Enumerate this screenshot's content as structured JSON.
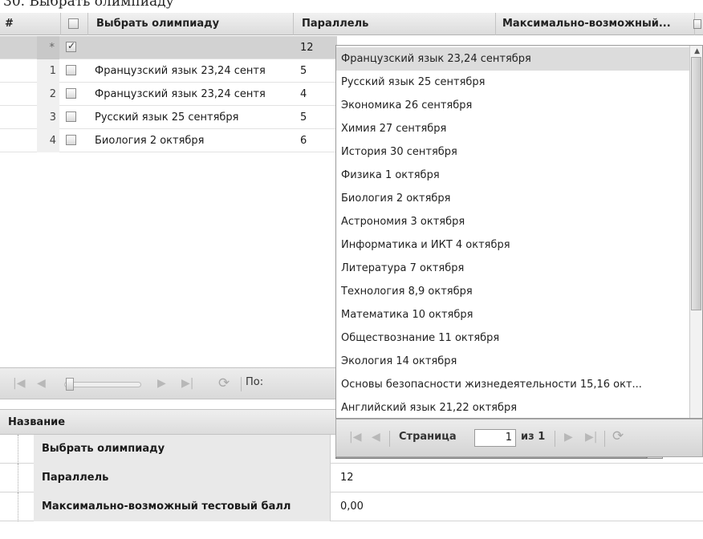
{
  "caption_fragment": "30. Выбрать олимпиаду",
  "grid": {
    "columns": {
      "num": "#",
      "olympiad": "Выбрать олимпиаду",
      "parallel": "Параллель",
      "maxscore": "Максимально-возможный..."
    },
    "rows": [
      {
        "num": "*",
        "checked": true,
        "olympiad": "",
        "parallel": "12"
      },
      {
        "num": "1",
        "checked": false,
        "olympiad": "Французский язык 23,24 сентя",
        "parallel": "5"
      },
      {
        "num": "2",
        "checked": false,
        "olympiad": "Французский язык 23,24 сентя",
        "parallel": "4"
      },
      {
        "num": "3",
        "checked": false,
        "olympiad": "Русский язык 25 сентября",
        "parallel": "5"
      },
      {
        "num": "4",
        "checked": false,
        "olympiad": "Биология 2 октября",
        "parallel": "6"
      }
    ],
    "pager_label": "По:"
  },
  "dropdown": {
    "items": [
      "Французский язык 23,24 сентября",
      "Русский язык 25 сентября",
      "Экономика 26 сентября",
      "Химия 27 сентября",
      "История 30 сентября",
      "Физика 1 октября",
      "Биология 2 октября",
      "Астрономия 3 октября",
      "Информатика и ИКТ 4 октября",
      "Литература 7 октября",
      "Технология 8,9 октября",
      "Математика 10 октября",
      "Обществознание 11 октября",
      "Экология 14 октября",
      "Основы безопасности жизнедеятельности 15,16 окт...",
      "Английский язык 21,22 октября"
    ],
    "pager": {
      "page_label": "Страница",
      "page_value": "1",
      "of_label": "из 1"
    }
  },
  "properties": {
    "header": "Название",
    "rows": [
      {
        "label": "Выбрать олимпиаду",
        "value": ""
      },
      {
        "label": "Параллель",
        "value": "12"
      },
      {
        "label": "Максимально-возможный тестовый балл",
        "value": "0,00"
      }
    ]
  }
}
